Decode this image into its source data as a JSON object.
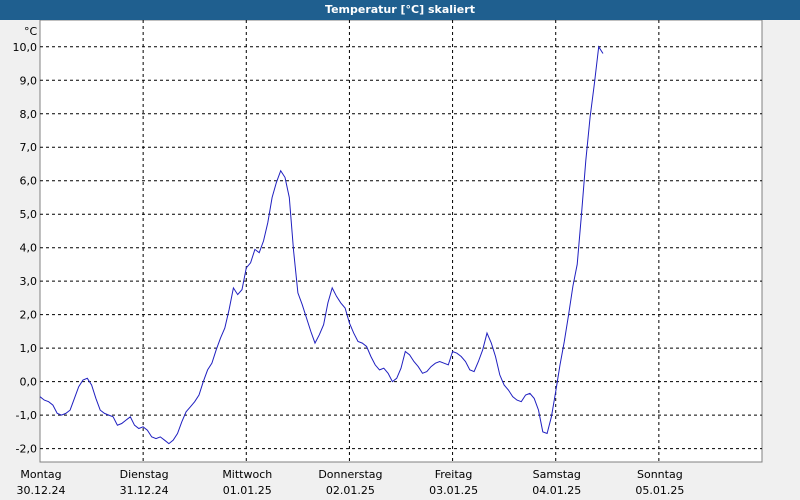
{
  "window": {
    "title": "Temperatur [°C] skaliert"
  },
  "chart_data": {
    "type": "line",
    "title": "Temperatur [°C] skaliert",
    "unit_label": "°C",
    "ylim": [
      -2.4,
      10.8
    ],
    "xlim": [
      0,
      168
    ],
    "grid": true,
    "y_ticks": [
      {
        "v": 10,
        "t": "10,0"
      },
      {
        "v": 9,
        "t": "9,0"
      },
      {
        "v": 8,
        "t": "8,0"
      },
      {
        "v": 7,
        "t": "7,0"
      },
      {
        "v": 6,
        "t": "6,0"
      },
      {
        "v": 5,
        "t": "5,0"
      },
      {
        "v": 4,
        "t": "4,0"
      },
      {
        "v": 3,
        "t": "3,0"
      },
      {
        "v": 2,
        "t": "2,0"
      },
      {
        "v": 1,
        "t": "1,0"
      },
      {
        "v": 0,
        "t": "0,0"
      },
      {
        "v": -1,
        "t": "-1,0"
      },
      {
        "v": -2,
        "t": "-2,0"
      }
    ],
    "x_ticks": [
      {
        "v": 0,
        "day": "Montag",
        "date": "30.12.24"
      },
      {
        "v": 24,
        "day": "Dienstag",
        "date": "31.12.24"
      },
      {
        "v": 48,
        "day": "Mittwoch",
        "date": "01.01.25"
      },
      {
        "v": 72,
        "day": "Donnerstag",
        "date": "02.01.25"
      },
      {
        "v": 96,
        "day": "Freitag",
        "date": "03.01.25"
      },
      {
        "v": 120,
        "day": "Samstag",
        "date": "04.01.25"
      },
      {
        "v": 144,
        "day": "Sonntag",
        "date": "05.01.25"
      }
    ],
    "series": [
      {
        "color": "#2020c0",
        "points": [
          [
            0,
            -0.45
          ],
          [
            1,
            -0.55
          ],
          [
            2,
            -0.6
          ],
          [
            3,
            -0.7
          ],
          [
            4,
            -0.95
          ],
          [
            5,
            -1.0
          ],
          [
            6,
            -0.95
          ],
          [
            7,
            -0.85
          ],
          [
            8,
            -0.5
          ],
          [
            9,
            -0.15
          ],
          [
            10,
            0.05
          ],
          [
            11,
            0.1
          ],
          [
            12,
            -0.1
          ],
          [
            13,
            -0.5
          ],
          [
            14,
            -0.85
          ],
          [
            15,
            -0.95
          ],
          [
            16,
            -1.0
          ],
          [
            17,
            -1.05
          ],
          [
            18,
            -1.3
          ],
          [
            19,
            -1.25
          ],
          [
            20,
            -1.15
          ],
          [
            21,
            -1.05
          ],
          [
            22,
            -1.3
          ],
          [
            23,
            -1.4
          ],
          [
            24,
            -1.35
          ],
          [
            25,
            -1.45
          ],
          [
            26,
            -1.65
          ],
          [
            27,
            -1.7
          ],
          [
            28,
            -1.65
          ],
          [
            29,
            -1.75
          ],
          [
            30,
            -1.85
          ],
          [
            31,
            -1.75
          ],
          [
            32,
            -1.55
          ],
          [
            33,
            -1.2
          ],
          [
            34,
            -0.9
          ],
          [
            35,
            -0.75
          ],
          [
            36,
            -0.6
          ],
          [
            37,
            -0.4
          ],
          [
            38,
            0.0
          ],
          [
            39,
            0.35
          ],
          [
            40,
            0.55
          ],
          [
            41,
            0.95
          ],
          [
            42,
            1.3
          ],
          [
            43,
            1.6
          ],
          [
            44,
            2.15
          ],
          [
            45,
            2.8
          ],
          [
            46,
            2.6
          ],
          [
            47,
            2.75
          ],
          [
            48,
            3.4
          ],
          [
            49,
            3.55
          ],
          [
            50,
            3.95
          ],
          [
            51,
            3.85
          ],
          [
            52,
            4.2
          ],
          [
            53,
            4.75
          ],
          [
            54,
            5.5
          ],
          [
            55,
            5.95
          ],
          [
            56,
            6.3
          ],
          [
            57,
            6.1
          ],
          [
            58,
            5.5
          ],
          [
            59,
            3.9
          ],
          [
            60,
            2.65
          ],
          [
            61,
            2.3
          ],
          [
            62,
            1.9
          ],
          [
            63,
            1.5
          ],
          [
            64,
            1.15
          ],
          [
            65,
            1.4
          ],
          [
            66,
            1.7
          ],
          [
            67,
            2.35
          ],
          [
            68,
            2.8
          ],
          [
            69,
            2.55
          ],
          [
            70,
            2.35
          ],
          [
            71,
            2.2
          ],
          [
            72,
            1.75
          ],
          [
            73,
            1.45
          ],
          [
            74,
            1.2
          ],
          [
            75,
            1.15
          ],
          [
            76,
            1.05
          ],
          [
            77,
            0.75
          ],
          [
            78,
            0.5
          ],
          [
            79,
            0.35
          ],
          [
            80,
            0.4
          ],
          [
            81,
            0.25
          ],
          [
            82,
            0.0
          ],
          [
            83,
            0.1
          ],
          [
            84,
            0.4
          ],
          [
            85,
            0.9
          ],
          [
            86,
            0.8
          ],
          [
            87,
            0.6
          ],
          [
            88,
            0.45
          ],
          [
            89,
            0.25
          ],
          [
            90,
            0.3
          ],
          [
            91,
            0.45
          ],
          [
            92,
            0.55
          ],
          [
            93,
            0.6
          ],
          [
            94,
            0.55
          ],
          [
            95,
            0.5
          ],
          [
            96,
            0.9
          ],
          [
            97,
            0.85
          ],
          [
            98,
            0.75
          ],
          [
            99,
            0.6
          ],
          [
            100,
            0.35
          ],
          [
            101,
            0.3
          ],
          [
            102,
            0.6
          ],
          [
            103,
            0.95
          ],
          [
            104,
            1.45
          ],
          [
            105,
            1.15
          ],
          [
            106,
            0.75
          ],
          [
            107,
            0.2
          ],
          [
            108,
            -0.1
          ],
          [
            109,
            -0.25
          ],
          [
            110,
            -0.45
          ],
          [
            111,
            -0.55
          ],
          [
            112,
            -0.6
          ],
          [
            113,
            -0.4
          ],
          [
            114,
            -0.35
          ],
          [
            115,
            -0.5
          ],
          [
            116,
            -0.85
          ],
          [
            117,
            -1.5
          ],
          [
            118,
            -1.55
          ],
          [
            119,
            -1.05
          ],
          [
            120,
            -0.3
          ],
          [
            121,
            0.5
          ],
          [
            122,
            1.2
          ],
          [
            123,
            2.0
          ],
          [
            124,
            2.85
          ],
          [
            125,
            3.5
          ],
          [
            126,
            5.0
          ],
          [
            127,
            6.6
          ],
          [
            128,
            7.9
          ],
          [
            129,
            8.9
          ],
          [
            130,
            10.0
          ],
          [
            131,
            9.8
          ]
        ]
      }
    ]
  }
}
